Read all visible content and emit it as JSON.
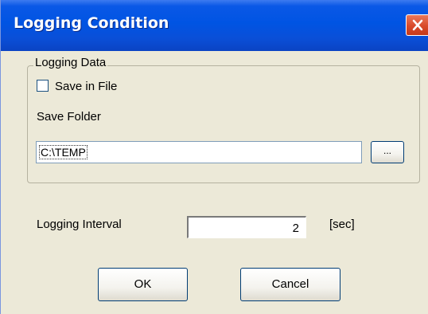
{
  "window": {
    "title": "Logging Condition"
  },
  "logging_data": {
    "group_title": "Logging Data",
    "save_in_file": {
      "label": "Save in File",
      "checked": false
    },
    "save_folder_label": "Save Folder",
    "folder_path": "C:\\TEMP",
    "browse_label": "..."
  },
  "logging_interval": {
    "label": "Logging Interval",
    "value": "2",
    "unit": "[sec]"
  },
  "buttons": {
    "ok": "OK",
    "cancel": "Cancel"
  }
}
